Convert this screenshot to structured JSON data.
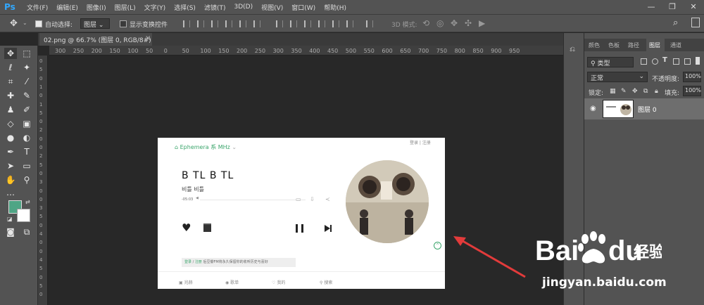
{
  "app": {
    "logo": "Ps"
  },
  "menu": [
    "文件(F)",
    "编辑(E)",
    "图像(I)",
    "图层(L)",
    "文字(Y)",
    "选择(S)",
    "滤镜(T)",
    "3D(D)",
    "视图(V)",
    "窗口(W)",
    "帮助(H)"
  ],
  "options": {
    "auto_select_label": "自动选择:",
    "auto_select_value": "图层",
    "show_transform_label": "显示变换控件",
    "mode_3d_label": "3D 模式:"
  },
  "document_tab": {
    "title": "02.png @ 66.7% (图层 0, RGB/8#)",
    "close": "×"
  },
  "ruler_top": [
    "300",
    "250",
    "200",
    "150",
    "100",
    "50",
    "0",
    "50",
    "100",
    "150",
    "200",
    "250",
    "300",
    "350",
    "400",
    "450",
    "500",
    "550",
    "600",
    "650",
    "700",
    "750",
    "800",
    "850",
    "900",
    "950"
  ],
  "ruler_left": [
    "0",
    "5",
    "0",
    "1",
    "0",
    "1",
    "5",
    "0",
    "2",
    "0",
    "0",
    "2",
    "5",
    "0",
    "3",
    "0",
    "0",
    "3",
    "5",
    "0",
    "4",
    "0",
    "0",
    "4",
    "5",
    "0",
    "5",
    "0"
  ],
  "doc": {
    "logo": "Ephemera 系 MHz",
    "top_links": "登录 | 注册",
    "title": "B TL B TL",
    "artist": "비틀 비틀",
    "time": "-05:03",
    "banner_login": "登录",
    "banner_sep": " / ",
    "banner_register": "注册",
    "banner_text": " 后豆瓣FM将永久保留你的收听历史与喜好",
    "nav": [
      "兆赫",
      "歌单",
      "我的",
      "搜索"
    ]
  },
  "panel": {
    "tabs": [
      "颜色",
      "色板",
      "路径",
      "图层",
      "通道"
    ],
    "active_tab": "图层",
    "kind": "类型",
    "blend": "正常",
    "opacity_label": "不透明度:",
    "opacity_value": "100%",
    "lock_label": "锁定:",
    "fill_label": "填充:",
    "fill_value": "100%",
    "layer_name": "图层 0"
  },
  "watermark": {
    "logo_left": "Bai",
    "logo_right": "du",
    "cn": "经验",
    "url": "jingyan.baidu.com"
  },
  "colors": {
    "accent_green": "#3aa56b",
    "foreground_swatch": "#4fa585",
    "arrow": "#e23b3b",
    "ps_blue": "#31a8ff"
  }
}
